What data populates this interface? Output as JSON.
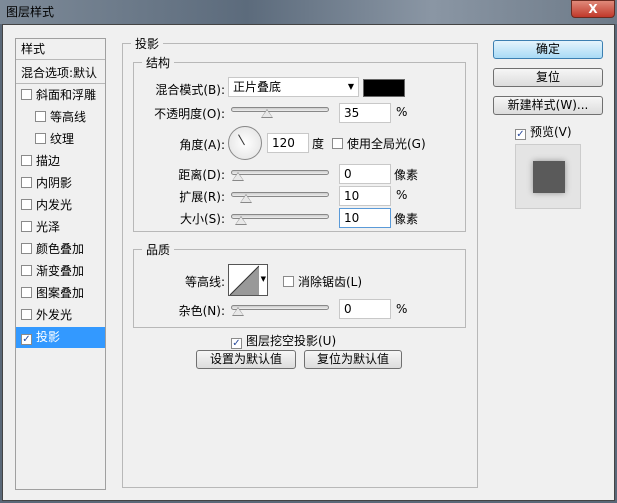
{
  "window": {
    "title": "图层样式",
    "close": "X"
  },
  "style_list": {
    "header": "样式",
    "items": [
      {
        "label": "混合选项:默认",
        "type": "header"
      },
      {
        "label": "斜面和浮雕",
        "checked": false
      },
      {
        "label": "等高线",
        "checked": false,
        "sub": true
      },
      {
        "label": "纹理",
        "checked": false,
        "sub": true
      },
      {
        "label": "描边",
        "checked": false
      },
      {
        "label": "内阴影",
        "checked": false
      },
      {
        "label": "内发光",
        "checked": false
      },
      {
        "label": "光泽",
        "checked": false
      },
      {
        "label": "颜色叠加",
        "checked": false
      },
      {
        "label": "渐变叠加",
        "checked": false
      },
      {
        "label": "图案叠加",
        "checked": false
      },
      {
        "label": "外发光",
        "checked": false
      },
      {
        "label": "投影",
        "checked": true,
        "selected": true
      }
    ]
  },
  "panel": {
    "title": "投影",
    "structure": {
      "title": "结构",
      "blend_mode_label": "混合模式(B):",
      "blend_mode": "正片叠底",
      "shadow_color": "#000000",
      "opacity_label": "不透明度(O):",
      "opacity": "35",
      "opacity_unit": "%",
      "opacity_fraction": 0.35,
      "angle_label": "角度(A):",
      "angle": "120",
      "angle_unit": "度",
      "global_light_label": "使用全局光(G)",
      "distance_label": "距离(D):",
      "distance": "0",
      "distance_unit": "像素",
      "distance_fraction": 0,
      "spread_label": "扩展(R):",
      "spread": "10",
      "spread_unit": "%",
      "spread_fraction": 0.1,
      "size_label": "大小(S):",
      "size": "10",
      "size_unit": "像素",
      "size_fraction": 0.04
    },
    "quality": {
      "title": "品质",
      "contour_label": "等高线:",
      "antialias_label": "消除锯齿(L)",
      "noise_label": "杂色(N):",
      "noise": "0",
      "noise_unit": "%",
      "noise_fraction": 0
    },
    "knockout_label": "图层挖空投影(U)",
    "set_default": "设置为默认值",
    "reset_default": "复位为默认值"
  },
  "buttons": {
    "ok": "确定",
    "reset": "复位",
    "new_style": "新建样式(W)...",
    "preview_label": "预览(V)"
  },
  "checkmark": "✓"
}
